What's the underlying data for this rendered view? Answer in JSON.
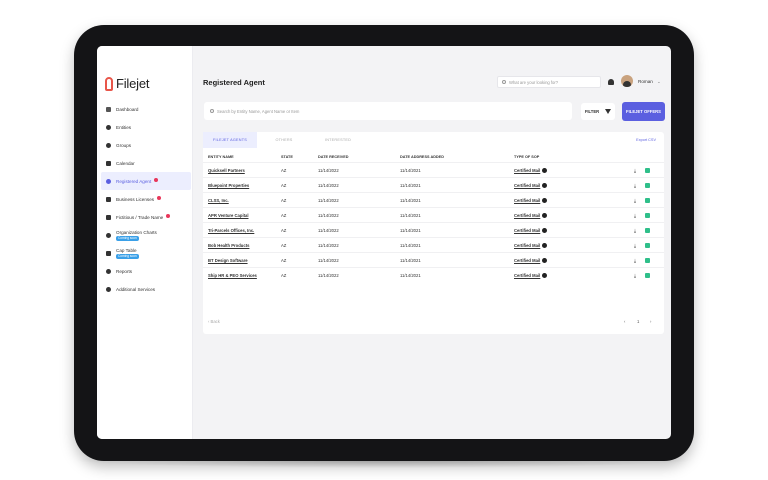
{
  "app": {
    "logo_text": "Filejet",
    "page_title": "Registered Agent",
    "brand_color": "#5b5fe0",
    "alert_color": "#e8365a"
  },
  "header": {
    "search_placeholder": "What are your looking for?",
    "user_name": "Roman",
    "user_chevron": "⌄"
  },
  "sidebar": {
    "items": [
      {
        "label": "Dashboard",
        "icon": "grid-icon"
      },
      {
        "label": "Entities",
        "icon": "entities-icon"
      },
      {
        "label": "Groups",
        "icon": "groups-icon"
      },
      {
        "label": "Calendar",
        "icon": "calendar-icon"
      },
      {
        "label": "Registered Agent",
        "icon": "user-icon",
        "active": true,
        "alert": true
      },
      {
        "label": "Business Licenses",
        "icon": "license-icon",
        "alert": true
      },
      {
        "label": "Fictitious / Trade Name",
        "icon": "trade-name-icon",
        "alert": true
      },
      {
        "label": "Organization Charts",
        "icon": "org-chart-icon",
        "badge": "Coming soon"
      },
      {
        "label": "Cap Table",
        "icon": "cap-table-icon",
        "badge": "Coming soon"
      },
      {
        "label": "Reports",
        "icon": "reports-icon"
      },
      {
        "label": "Additional Services",
        "icon": "services-icon"
      }
    ]
  },
  "toolbar": {
    "search_placeholder": "Search by Entity Name, Agent Name or Item",
    "filter_label": "FILTER",
    "offers_label": "FILEJET OFFERS"
  },
  "panel": {
    "tabs": [
      "FILEJET AGENTS",
      "OTHERS",
      "INTERESTED"
    ],
    "export_label": "Export CSV",
    "columns": [
      "ENTITY NAME",
      "STATE",
      "DATE RECEIVED",
      "DATE ADDRESS ADDED",
      "TYPE OF SOP"
    ],
    "rows": [
      {
        "entity": "Quicksell Partners",
        "state": "AZ",
        "date_received": "11/14/2022",
        "date_added": "11/14/2021",
        "sop": "Certified Mail"
      },
      {
        "entity": "Bluepoint Properties",
        "state": "AZ",
        "date_received": "11/14/2022",
        "date_added": "11/14/2021",
        "sop": "Certified Mail"
      },
      {
        "entity": "CLSS, Inc.",
        "state": "AZ",
        "date_received": "11/14/2022",
        "date_added": "11/14/2021",
        "sop": "Certified Mail"
      },
      {
        "entity": "APR Venture Capital",
        "state": "AZ",
        "date_received": "11/14/2022",
        "date_added": "11/14/2021",
        "sop": "Certified Mail"
      },
      {
        "entity": "Tri-Parcels Offices, Inc.",
        "state": "AZ",
        "date_received": "11/14/2022",
        "date_added": "11/14/2021",
        "sop": "Certified Mail"
      },
      {
        "entity": "Bob Health Products",
        "state": "AZ",
        "date_received": "11/14/2022",
        "date_added": "11/14/2021",
        "sop": "Certified Mail"
      },
      {
        "entity": "BT Design Software",
        "state": "AZ",
        "date_received": "11/14/2022",
        "date_added": "11/14/2021",
        "sop": "Certified Mail"
      },
      {
        "entity": "Ship HR & PEO Services",
        "state": "AZ",
        "date_received": "11/14/2022",
        "date_added": "11/14/2021",
        "sop": "Certified Mail"
      }
    ],
    "pager_back": "‹ Back",
    "page_prev": "‹",
    "page_current": "1",
    "page_next": "›"
  }
}
